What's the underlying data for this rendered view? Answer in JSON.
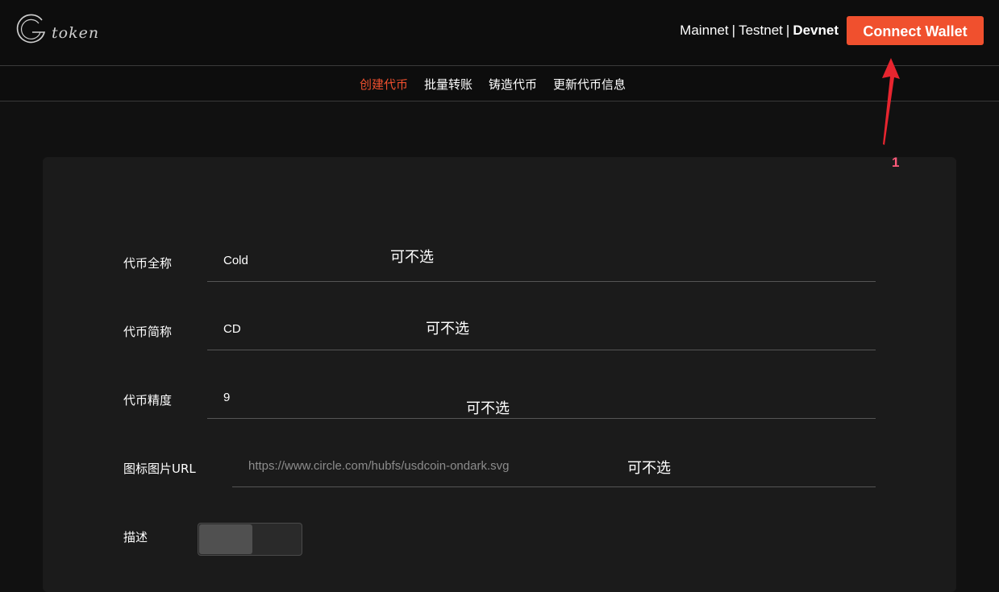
{
  "header": {
    "logo_text": "token",
    "networks": [
      "Mainnet",
      "Testnet",
      "Devnet"
    ],
    "network_separator": "|",
    "active_network": "Devnet",
    "connect_button": "Connect Wallet"
  },
  "nav": {
    "tabs": [
      {
        "label": "创建代币",
        "active": true
      },
      {
        "label": "批量转账",
        "active": false
      },
      {
        "label": "铸造代币",
        "active": false
      },
      {
        "label": "更新代币信息",
        "active": false
      }
    ]
  },
  "annotation": {
    "number": "1",
    "color": "#e8252f"
  },
  "form": {
    "fields": [
      {
        "label": "代币全称",
        "value": "Cold",
        "note": "可不选"
      },
      {
        "label": "代币简称",
        "value": "CD",
        "note": "可不选"
      },
      {
        "label": "代币精度",
        "value": "9",
        "note": "可不选"
      },
      {
        "label": "图标图片URL",
        "placeholder": "https://www.circle.com/hubfs/usdcoin-ondark.svg",
        "note": "可不选"
      }
    ],
    "description_label": "描述",
    "description_toggle_on": false
  },
  "colors": {
    "accent": "#f0502e",
    "background": "#111111",
    "card": "#1b1b1b"
  }
}
